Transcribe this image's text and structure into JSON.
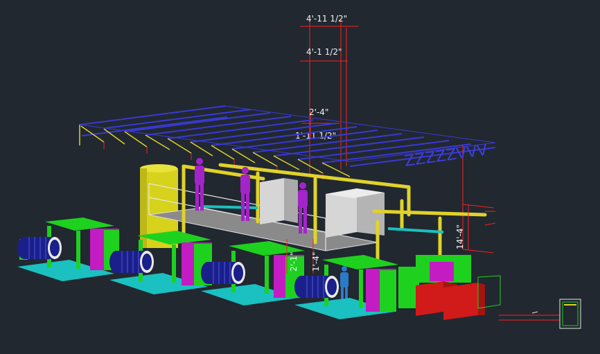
{
  "drawing": {
    "background": "#212830",
    "colors": {
      "tray": "#3333cc",
      "pipe": "#e0d22a",
      "skid_green": "#1fd11f",
      "skid_cyan": "#1bc0c0",
      "magenta": "#c21cc2",
      "tank": "#d7d21c",
      "box": "#c9c9c9",
      "red": "#d11a1a",
      "pump": "#1a1f8a",
      "dim": "#ff2020",
      "person": "#a424c9"
    },
    "dimensions": {
      "d1": "4'-11 1/2\"",
      "d2": "4'-1 1/2\"",
      "d3": "2'-4\"",
      "d4": "1'-11 1/2\"",
      "d5": "14'-4\"",
      "d6": "2'-1\"",
      "d7": "1'-4\""
    }
  }
}
